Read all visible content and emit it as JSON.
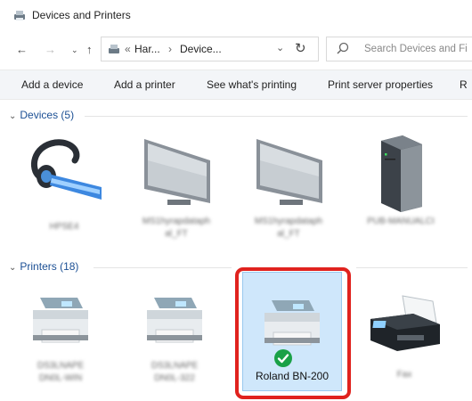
{
  "window": {
    "title": "Devices and Printers"
  },
  "address": {
    "crumbs": [
      "Har...",
      "Device..."
    ],
    "search_placeholder": "Search Devices and Fi"
  },
  "commands": {
    "add_device": "Add a device",
    "add_printer": "Add a printer",
    "see_printing": "See what's printing",
    "print_server": "Print server properties",
    "remove": "R"
  },
  "groups": {
    "devices": {
      "label": "Devices (5)"
    },
    "printers": {
      "label": "Printers (18)"
    }
  },
  "devices": [
    {
      "label": "HPSE4",
      "icon": "headset-icon"
    },
    {
      "label": "MS1hyrapdataph\nal_FT",
      "icon": "monitor-icon"
    },
    {
      "label": "MS1hyrapdataph\nal_FT",
      "icon": "monitor-icon"
    },
    {
      "label": "PUB-MANUALCI",
      "icon": "computer-tower-icon"
    }
  ],
  "printers": [
    {
      "label": "DS3LNAPE\nDN0L-WIN",
      "icon": "printer-icon"
    },
    {
      "label": "DS3LNAPE\nDN0L-322",
      "icon": "printer-icon"
    },
    {
      "label": "Roland BN-200",
      "icon": "printer-icon",
      "selected": true,
      "default": true
    },
    {
      "label": "Fax",
      "icon": "fax-icon"
    }
  ],
  "colors": {
    "accent": "#1b4f94",
    "highlight": "#e0221e",
    "selection": "#cfe7fb",
    "default_check": "#1aa147"
  }
}
